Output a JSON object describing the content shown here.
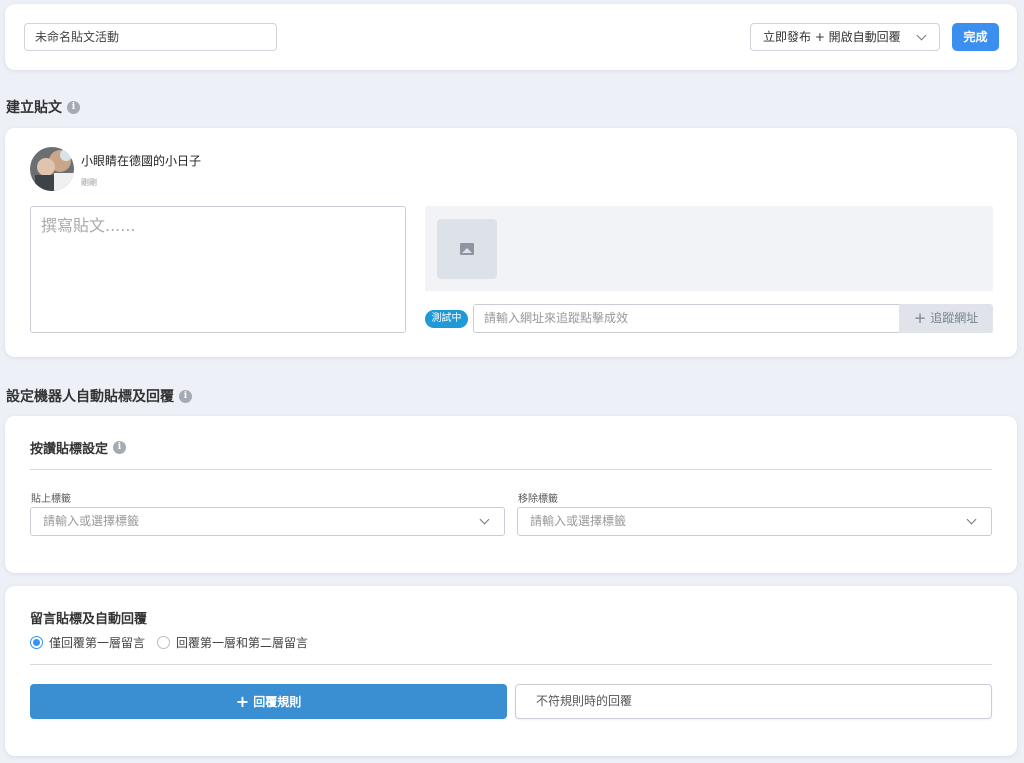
{
  "top_bar": {
    "activity_name": "未命名貼文活動",
    "publish_option": "立即發布 + 開啟自動回覆",
    "done_label": "完成"
  },
  "create_post": {
    "section_title": "建立貼文",
    "page_name": "小眼睛在德國的小日子",
    "page_sub": "剛剛",
    "textarea_placeholder": "撰寫貼文......",
    "testing_badge": "測試中",
    "url_placeholder": "請輸入網址來追蹤點擊成效",
    "track_url_label": "追蹤網址"
  },
  "bot_section": {
    "section_title": "設定機器人自動貼標及回覆"
  },
  "like_tagging": {
    "title": "按讚貼標設定",
    "add_tag_label": "貼上標籤",
    "add_tag_placeholder": "請輸入或選擇標籤",
    "remove_tag_label": "移除標籤",
    "remove_tag_placeholder": "請輸入或選擇標籤"
  },
  "comment_tagging": {
    "title": "留言貼標及自動回覆",
    "options": [
      {
        "label": "僅回覆第一層留言",
        "selected": true
      },
      {
        "label": "回覆第一層和第二層留言",
        "selected": false
      }
    ],
    "reply_rule_label": "回覆規則",
    "no_match_label": "不符規則時的回覆"
  },
  "colors": {
    "primary": "#3b8ff0",
    "rule_button": "#3a8fd2",
    "badge": "#1f9ad6",
    "background": "#edf1f7"
  }
}
